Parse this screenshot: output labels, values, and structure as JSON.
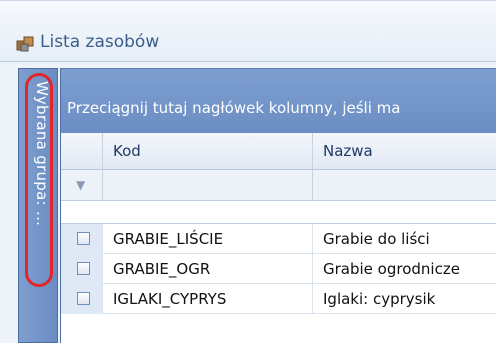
{
  "window": {
    "title": "Lista zasobów",
    "icon": "resources-icon"
  },
  "side_panel": {
    "label": "Wybrana grupa: ..."
  },
  "grid": {
    "group_hint": "Przeciągnij tutaj nagłówek kolumny, jeśli ma",
    "columns": [
      "Kod",
      "Nazwa"
    ],
    "rows": [
      {
        "kod": "GRABIE_LIŚCIE",
        "nazwa": "Grabie do liści"
      },
      {
        "kod": "GRABIE_OGR",
        "nazwa": "Grabie ogrodnicze"
      },
      {
        "kod": "IGLAKI_CYPRYS",
        "nazwa": "Iglaki: cyprysik"
      }
    ]
  },
  "colors": {
    "panel_blue": "#7e9fd0",
    "highlight": "#e0252b"
  }
}
